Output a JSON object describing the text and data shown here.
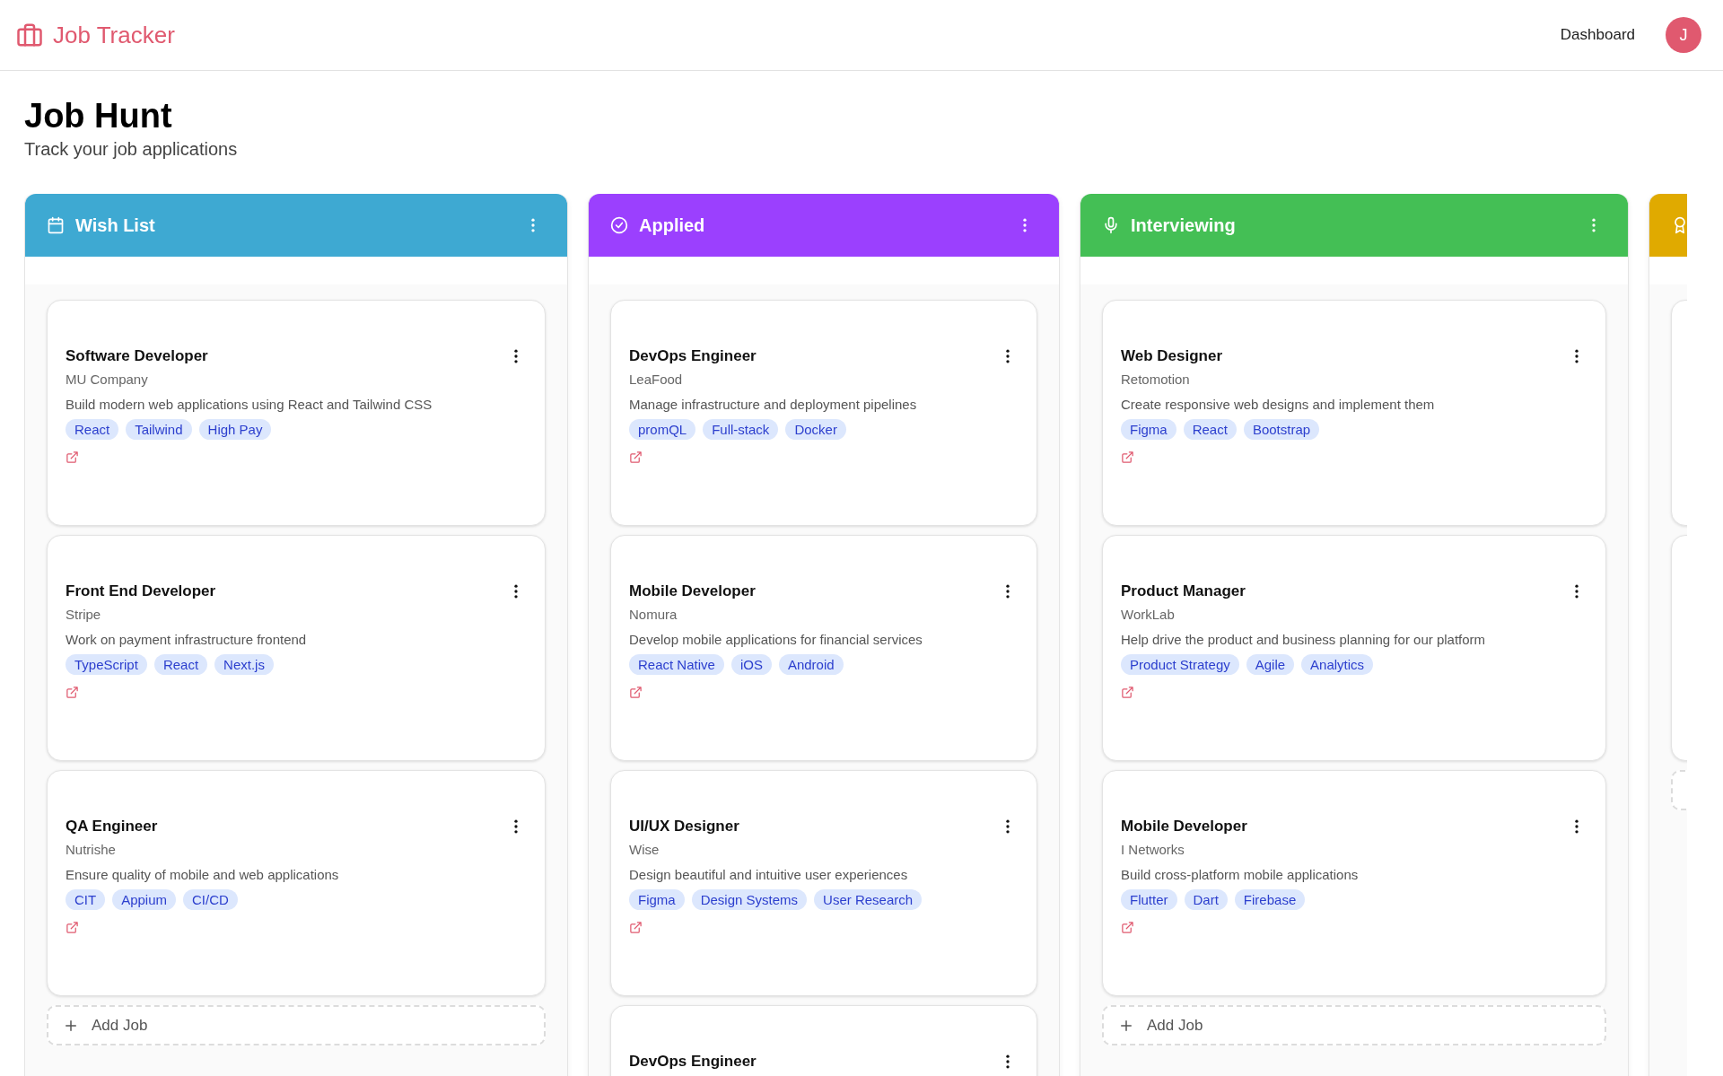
{
  "app": {
    "title": "Job Tracker",
    "nav_link": "Dashboard",
    "avatar": "J"
  },
  "page": {
    "title": "Job Hunt",
    "subtitle": "Track your job applications"
  },
  "columns": [
    {
      "title": "Wish List",
      "kind": "calendar",
      "color": "#3ea9d2",
      "add_box": true,
      "add_label": "Add Job",
      "cards": [
        {
          "kind": "job",
          "title": "Software Developer",
          "company": "MU Company",
          "description": "Build modern web applications using React and Tailwind CSS",
          "tags": [
            "React",
            "Tailwind",
            "High Pay"
          ]
        },
        {
          "kind": "job",
          "title": "Front End Developer",
          "company": "Stripe",
          "description": "Work on payment infrastructure frontend",
          "tags": [
            "TypeScript",
            "React",
            "Next.js"
          ]
        },
        {
          "kind": "job",
          "title": "QA Engineer",
          "company": "Nutrishe",
          "description": "Ensure quality of mobile and web applications",
          "tags": [
            "CIT",
            "Appium",
            "CI/CD"
          ]
        }
      ]
    },
    {
      "title": "Applied",
      "kind": "check",
      "color": "#9b40fe",
      "cards": [
        {
          "kind": "job",
          "title": "DevOps Engineer",
          "company": "LeaFood",
          "description": "Manage infrastructure and deployment pipelines",
          "tags": [
            "promQL",
            "Full-stack",
            "Docker"
          ]
        },
        {
          "kind": "job",
          "title": "Mobile Developer",
          "company": "Nomura",
          "description": "Develop mobile applications for financial services",
          "tags": [
            "React Native",
            "iOS",
            "Android"
          ]
        },
        {
          "kind": "job",
          "title": "UI/UX Designer",
          "company": "Wise",
          "description": "Design beautiful and intuitive user experiences",
          "tags": [
            "Figma",
            "Design Systems",
            "User Research"
          ]
        },
        {
          "kind": "job",
          "title": "DevOps Engineer"
        }
      ]
    },
    {
      "title": "Interviewing",
      "kind": "mic",
      "color": "#44bf55",
      "add_box": true,
      "add_label": "Add Job",
      "cards": [
        {
          "kind": "job",
          "title": "Web Designer",
          "company": "Retomotion",
          "description": "Create responsive web designs and implement them",
          "tags": [
            "Figma",
            "React",
            "Bootstrap"
          ]
        },
        {
          "kind": "job",
          "title": "Product Manager",
          "company": "WorkLab",
          "description": "Help drive the product and business planning for our platform",
          "tags": [
            "Product Strategy",
            "Agile",
            "Analytics"
          ]
        },
        {
          "kind": "job",
          "title": "Mobile Developer",
          "company": "I Networks",
          "description": "Build cross-platform mobile applications",
          "tags": [
            "Flutter",
            "Dart",
            "Firebase"
          ]
        }
      ]
    },
    {
      "kind": "award",
      "color": "#e0aa00",
      "add_box": true,
      "cards": [
        {
          "kind": "blank"
        },
        {
          "kind": "blank"
        }
      ]
    }
  ]
}
